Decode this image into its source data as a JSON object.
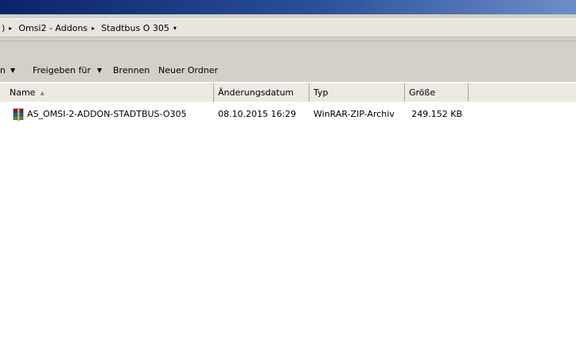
{
  "address": {
    "crumbs": [
      {
        "label": ")"
      },
      {
        "label": "Omsi2 - Addons"
      },
      {
        "label": "Stadtbus O 305"
      }
    ]
  },
  "toolbar": {
    "organize_label": "n",
    "share_label": "Freigeben für",
    "burn_label": "Brennen",
    "new_folder_label": "Neuer Ordner"
  },
  "columns": {
    "name": "Name",
    "date": "Änderungsdatum",
    "type": "Typ",
    "size": "Größe"
  },
  "files": [
    {
      "name": "AS_OMSI-2-ADDON-STADTBUS-O305",
      "date": "08.10.2015 16:29",
      "type": "WinRAR-ZIP-Archiv",
      "size": "249.152 KB",
      "icon": "winrar-archive-icon"
    }
  ],
  "colors": {
    "titlebar_start": "#0a246a",
    "titlebar_end": "#6d8ec8",
    "chrome": "#d4d0c8"
  }
}
